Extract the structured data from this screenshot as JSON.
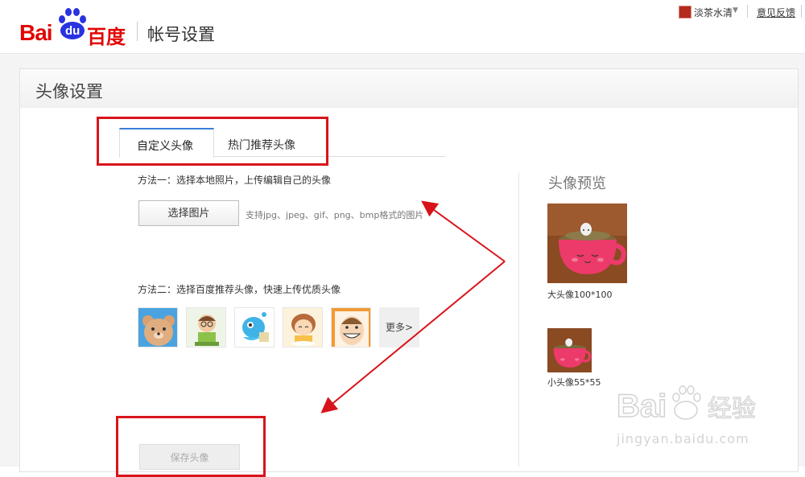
{
  "header": {
    "logo_bai": "Bai",
    "logo_du": "du",
    "logo_cn": "百度",
    "title": "帐号设置",
    "username": "淡茶水清",
    "feedback": "意见反馈"
  },
  "page": {
    "title": "头像设置",
    "tabs": [
      {
        "label": "自定义头像",
        "active": true
      },
      {
        "label": "热门推荐头像",
        "active": false
      }
    ],
    "method1": {
      "label": "方法一：选择本地照片，上传编辑自己的头像",
      "button": "选择图片",
      "hint": "支持jpg、jpeg、gif、png、bmp格式的图片"
    },
    "method2": {
      "label": "方法二：选择百度推荐头像，快速上传优质头像",
      "avatars": [
        "bear-avatar",
        "man-glasses-avatar",
        "blue-fish-avatar",
        "girl-avatar",
        "smiling-man-avatar"
      ],
      "more": "更多>"
    },
    "save_button": "保存头像"
  },
  "preview": {
    "title": "头像预览",
    "big_caption": "大头像100*100",
    "small_caption": "小头像55*55"
  },
  "watermark": {
    "logo": "Bai du 经验",
    "url": "jingyan.baidu.com"
  },
  "colors": {
    "brand_red": "#e10602",
    "brand_blue": "#2932e1",
    "highlight_red": "#d8141b",
    "tab_accent": "#3a7fd5"
  }
}
